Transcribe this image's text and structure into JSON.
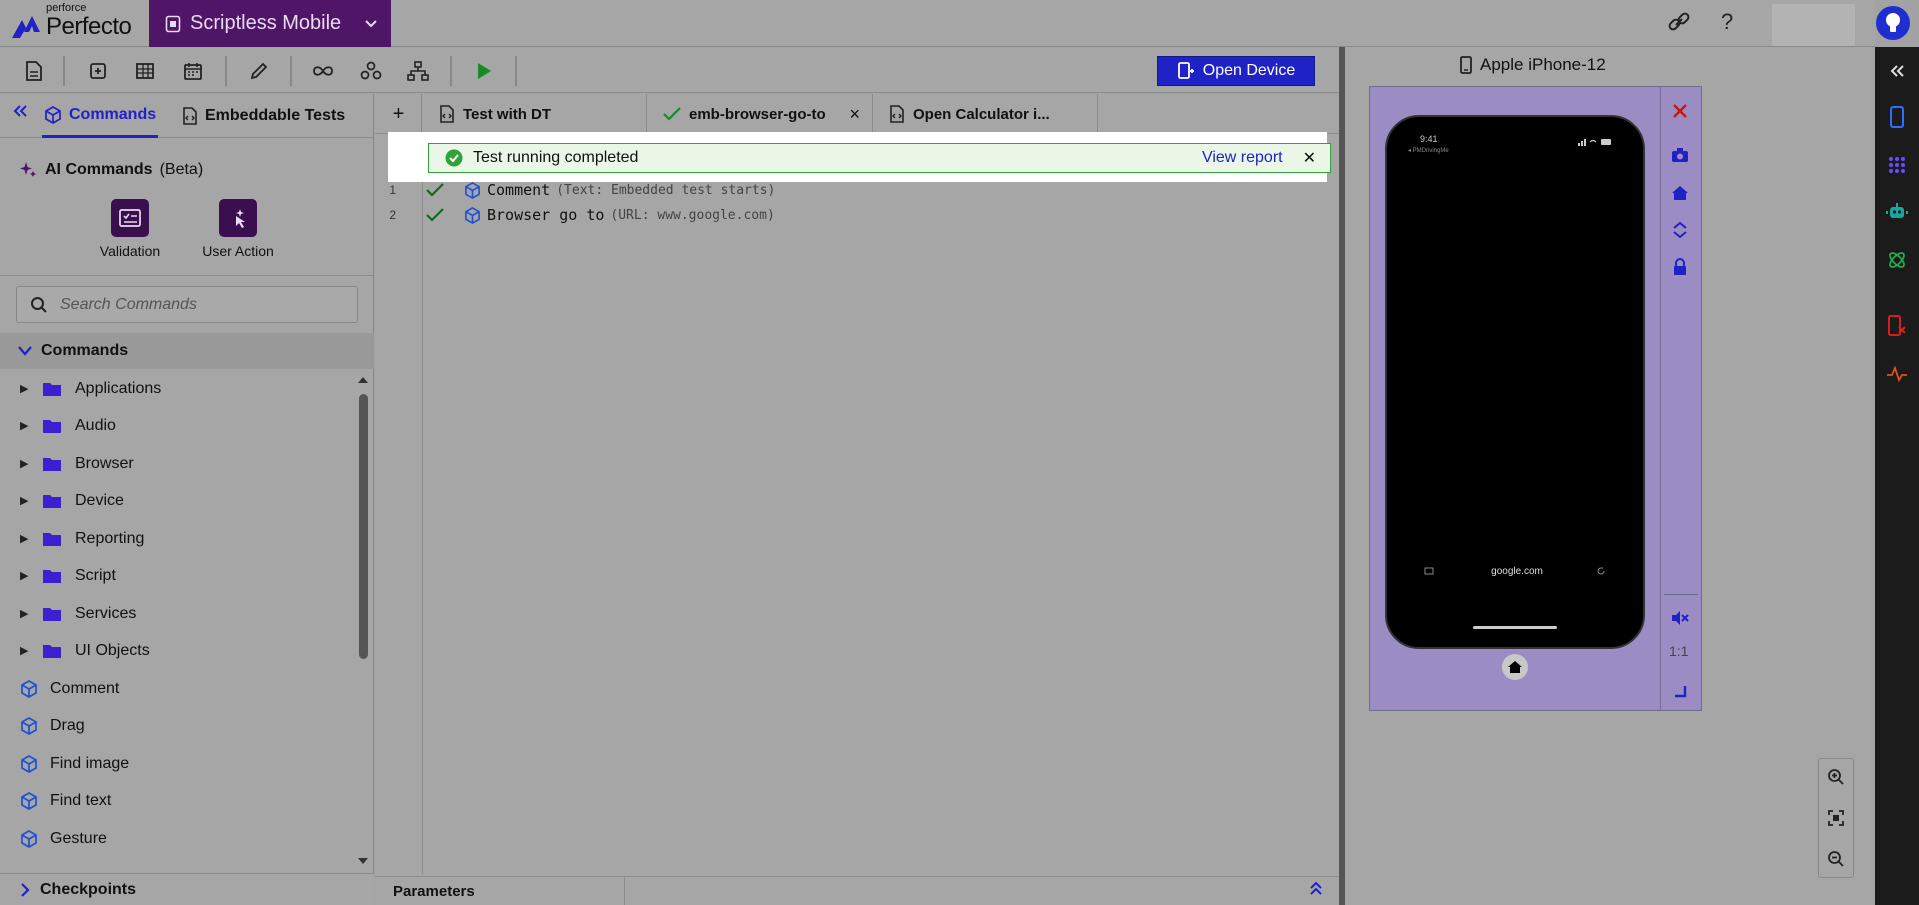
{
  "header": {
    "brand_small": "perforce",
    "brand": "Perfecto",
    "product": "Scriptless Mobile",
    "help": "?"
  },
  "toolbar": {
    "open_device": "Open Device"
  },
  "left_panel": {
    "tabs": [
      "Commands",
      "Embeddable Tests"
    ],
    "ai": {
      "title": "AI Commands",
      "badge": "(Beta)",
      "buttons": [
        "Validation",
        "User Action"
      ]
    },
    "search_placeholder": "Search Commands",
    "section_title": "Commands",
    "folders": [
      "Applications",
      "Audio",
      "Browser",
      "Device",
      "Reporting",
      "Script",
      "Services",
      "UI Objects"
    ],
    "commands": [
      "Comment",
      "Drag",
      "Find image",
      "Find text",
      "Gesture"
    ],
    "checkpoints": "Checkpoints"
  },
  "editor": {
    "tabs": [
      {
        "label": "Test with DT"
      },
      {
        "label": "emb-browser-go-to"
      },
      {
        "label": "Open Calculator i..."
      }
    ],
    "banner": {
      "message": "Test running completed",
      "link": "View report"
    },
    "lines": [
      {
        "num": "1",
        "cmd": "Comment",
        "param": "(Text: Embedded test starts)"
      },
      {
        "num": "2",
        "cmd": "Browser go to",
        "param": "(URL: www.google.com)"
      }
    ],
    "parameters_label": "Parameters"
  },
  "device": {
    "title": "Apple iPhone-12",
    "time": "9:41",
    "back_app": "◂ PMDrivingMe",
    "url": "google.com",
    "ratio": "1:1"
  },
  "colors": {
    "accent": "#1f22c4",
    "product_bg": "#4f1566",
    "success": "#2fa33a",
    "device_frame": "#9c8cc4"
  }
}
